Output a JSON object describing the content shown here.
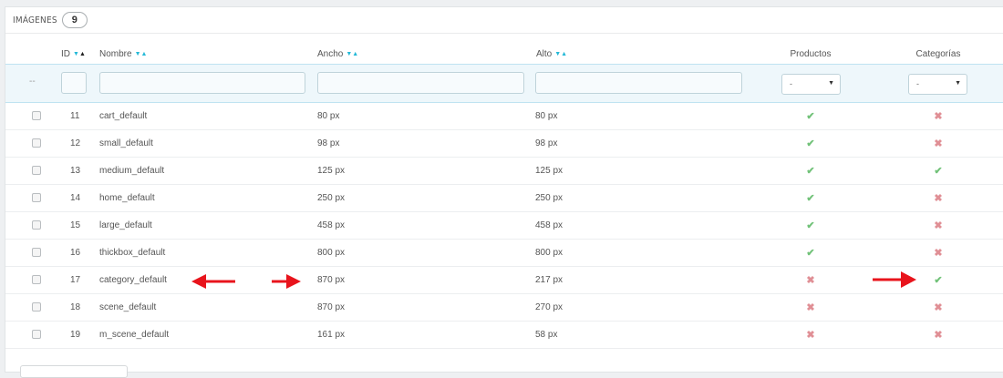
{
  "panel": {
    "title": "IMÁGENES",
    "count": "9"
  },
  "columns": {
    "id": "ID",
    "name": "Nombre",
    "width": "Ancho",
    "height": "Alto",
    "products": "Productos",
    "categories": "Categorías"
  },
  "filters": {
    "dash": "--",
    "products_select": "-",
    "categories_select": "-"
  },
  "rows": [
    {
      "id": "11",
      "name": "cart_default",
      "width": "80 px",
      "height": "80 px",
      "products": "check",
      "categories": "cross"
    },
    {
      "id": "12",
      "name": "small_default",
      "width": "98 px",
      "height": "98 px",
      "products": "check",
      "categories": "cross"
    },
    {
      "id": "13",
      "name": "medium_default",
      "width": "125 px",
      "height": "125 px",
      "products": "check",
      "categories": "check"
    },
    {
      "id": "14",
      "name": "home_default",
      "width": "250 px",
      "height": "250 px",
      "products": "check",
      "categories": "cross"
    },
    {
      "id": "15",
      "name": "large_default",
      "width": "458 px",
      "height": "458 px",
      "products": "check",
      "categories": "cross"
    },
    {
      "id": "16",
      "name": "thickbox_default",
      "width": "800 px",
      "height": "800 px",
      "products": "check",
      "categories": "cross"
    },
    {
      "id": "17",
      "name": "category_default",
      "width": "870 px",
      "height": "217 px",
      "products": "cross",
      "categories": "check"
    },
    {
      "id": "18",
      "name": "scene_default",
      "width": "870 px",
      "height": "270 px",
      "products": "cross",
      "categories": "cross"
    },
    {
      "id": "19",
      "name": "m_scene_default",
      "width": "161 px",
      "height": "58 px",
      "products": "cross",
      "categories": "cross"
    }
  ],
  "icons": {
    "check": "✔",
    "cross": "✖",
    "sort_down": "▼",
    "sort_up": "▲",
    "caret": "▼"
  },
  "colors": {
    "accent": "#25b9d7",
    "check": "#72c279",
    "cross": "#e08f95",
    "arrow": "#e8141c"
  }
}
